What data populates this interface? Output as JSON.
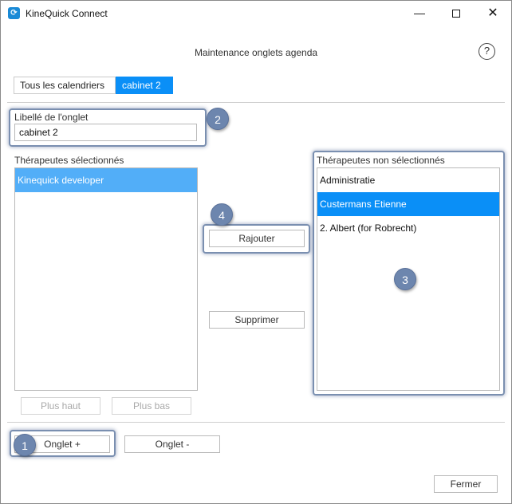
{
  "window": {
    "title": "KineQuick Connect",
    "minimize_glyph": "—",
    "close_glyph": "✕"
  },
  "page": {
    "title": "Maintenance onglets agenda",
    "help_glyph": "?"
  },
  "tabs": [
    {
      "label": "Tous les calendriers",
      "selected": false
    },
    {
      "label": "cabinet 2",
      "selected": true
    }
  ],
  "tab_label": {
    "label": "Libellé de l'onglet",
    "value": "cabinet 2"
  },
  "selected_therapists": {
    "label": "Thérapeutes sélectionnés",
    "items": [
      "Kinequick developer"
    ]
  },
  "unselected_therapists": {
    "label": "Thérapeutes non sélectionnés",
    "items": [
      "Administratie",
      "Custermans Etienne",
      "2. Albert (for Robrecht)"
    ],
    "selected_index": 1
  },
  "buttons": {
    "add": "Rajouter",
    "remove": "Supprimer",
    "move_up": "Plus haut",
    "move_down": "Plus bas",
    "tab_add": "Onglet +",
    "tab_remove": "Onglet -",
    "close": "Fermer"
  },
  "callouts": [
    "1",
    "2",
    "3",
    "4"
  ],
  "colors": {
    "accent": "#0a8ff7",
    "callout": "#6d86ae"
  }
}
